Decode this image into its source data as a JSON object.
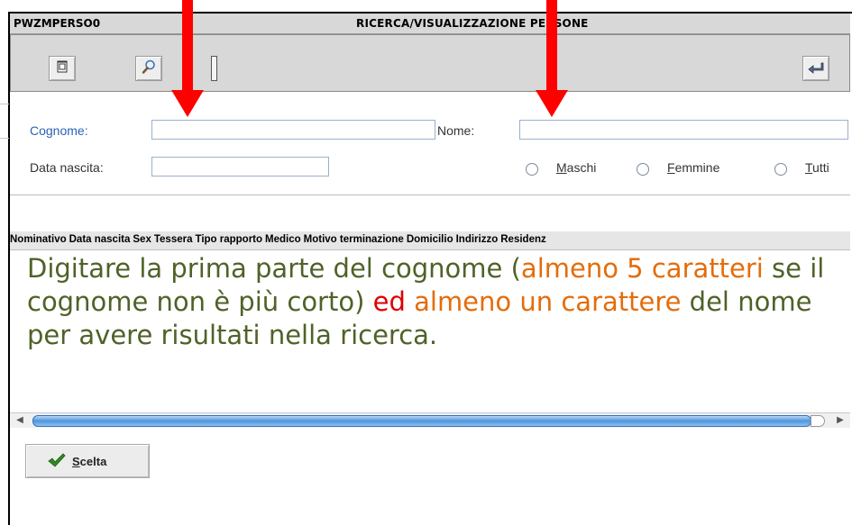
{
  "window": {
    "code": "PWZMPERSO0",
    "title": "RICERCA/VISUALIZZAZIONE PERSONE"
  },
  "toolbar": {
    "new_icon": "document-icon",
    "search_icon": "magnifier-icon",
    "back_icon": "return-arrow-icon"
  },
  "form": {
    "cognome_label": "Cognome:",
    "cognome_value": "",
    "nome_label": "Nome:",
    "nome_value": "",
    "data_nascita_label": "Data nascita:",
    "data_nascita_value": "",
    "radio_options": [
      {
        "prefix": "",
        "underlined": "M",
        "rest": "aschi"
      },
      {
        "prefix": "",
        "underlined": "F",
        "rest": "emmine"
      },
      {
        "prefix": "",
        "underlined": "T",
        "rest": "utti"
      }
    ]
  },
  "grid": {
    "columns": [
      "Nominativo",
      "Data nascita",
      "Sex",
      "Tessera",
      "Tipo rapporto",
      "Medico",
      "Motivo terminazione",
      "Domicilio",
      "Indirizzo",
      "Residenz"
    ]
  },
  "annotation": {
    "parts": [
      {
        "text": "Digitare la prima parte del cognome (",
        "color": "green"
      },
      {
        "text": "almeno 5 caratteri",
        "color": "orange"
      },
      {
        "text": " se il cognome non è più corto) ",
        "color": "green"
      },
      {
        "text": "ed",
        "color": "red"
      },
      {
        "text": " ",
        "color": "green"
      },
      {
        "text": "almeno un carattere",
        "color": "orange"
      },
      {
        "text": " del nome per avere risultati nella ricerca.",
        "color": "green"
      }
    ]
  },
  "actions": {
    "scelta_underlined": "S",
    "scelta_rest": "celta"
  },
  "colors": {
    "arrow": "#ff0000",
    "annotation_green": "#4f6228",
    "annotation_orange": "#e46c0a",
    "annotation_red": "#e00000"
  }
}
